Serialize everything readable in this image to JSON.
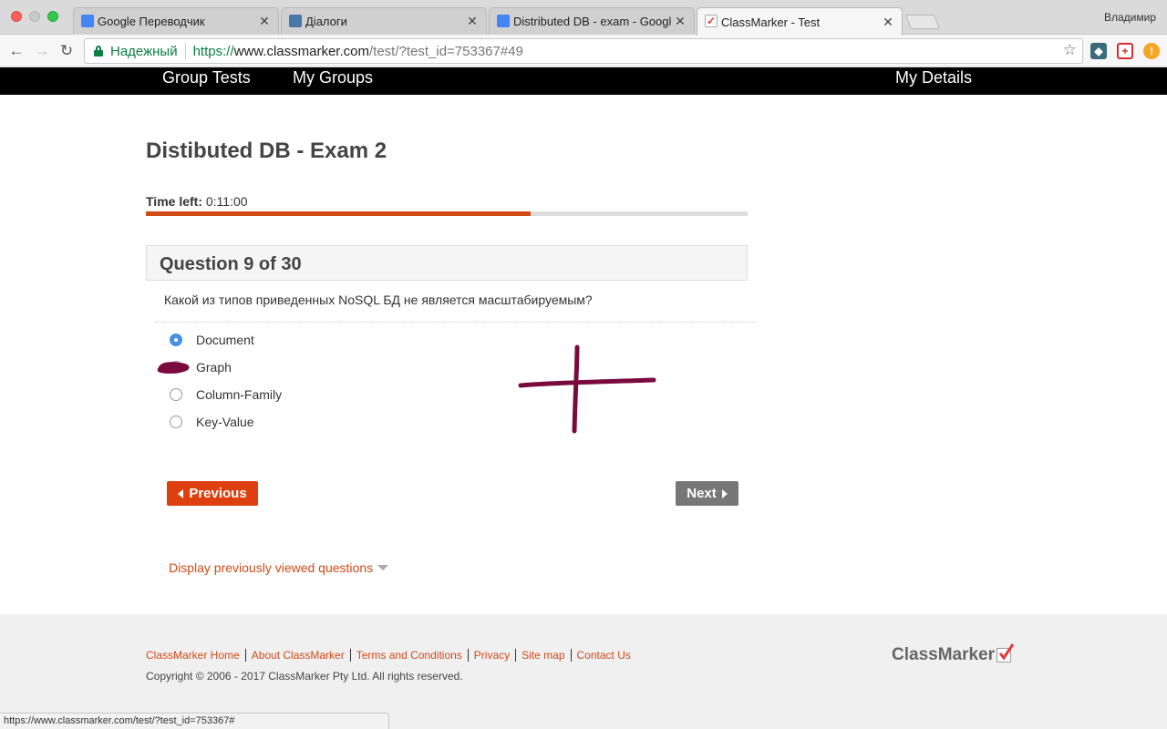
{
  "browser": {
    "tabs": [
      {
        "title": "Google Переводчик",
        "favicon": "google-translate-icon",
        "color": "#4285f4"
      },
      {
        "title": "Діалоги",
        "favicon": "chat-icon",
        "color": "#4a76a8"
      },
      {
        "title": "Distributed DB - exam - Googl",
        "favicon": "docs-icon",
        "color": "#4285f4"
      },
      {
        "title": "ClassMarker - Test",
        "favicon": "classmarker-check-icon",
        "color": "#e53935"
      }
    ],
    "profile_name": "Владимир",
    "secure_label": "Надежный",
    "url_scheme": "https://",
    "url_host": "www.classmarker.com",
    "url_path": "/test/?test_id=753367#49",
    "status_url": "https://www.classmarker.com/test/?test_id=753367#"
  },
  "nav": {
    "group_tests": "Group Tests",
    "my_groups": "My Groups",
    "my_details": "My Details"
  },
  "test": {
    "title": "Distibuted DB - Exam 2",
    "time_label": "Time left:",
    "time_value": "0:11:00",
    "progress_fraction": 0.64,
    "question_header": "Question 9 of 30",
    "question_text": "Какой из типов приведенных NoSQL БД не является масштабируемым?",
    "answers": [
      "Document",
      "Graph",
      "Column-Family",
      "Key-Value"
    ],
    "selected_index": 0,
    "previous_label": "Previous",
    "next_label": "Next",
    "prev_questions_link": "Display previously viewed questions"
  },
  "footer": {
    "links": [
      "ClassMarker Home",
      "About ClassMarker",
      "Terms and Conditions",
      "Privacy",
      "Site map",
      "Contact Us"
    ],
    "copyright": "Copyright © 2006 - 2017 ClassMarker Pty Ltd. All rights reserved.",
    "logo_text": "ClassMarker"
  },
  "colors": {
    "accent": "#d24a17",
    "annotation": "#7a0a3e"
  }
}
